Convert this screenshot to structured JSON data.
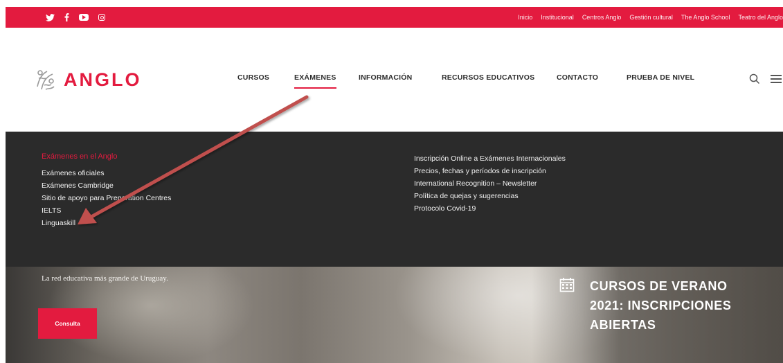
{
  "topbar": {
    "social": [
      "twitter-icon",
      "facebook-icon",
      "youtube-icon",
      "instagram-icon"
    ],
    "links": [
      "Inicio",
      "Institucional",
      "Centros Anglo",
      "Gestión cultural",
      "The Anglo School",
      "Teatro del Anglo"
    ]
  },
  "header": {
    "logo_text": "ANGLO",
    "nav": [
      "CURSOS",
      "EXÁMENES",
      "INFORMACIÓN",
      "RECURSOS EDUCATIVOS",
      "CONTACTO",
      "PRUEBA DE NIVEL"
    ],
    "active_nav": "EXÁMENES"
  },
  "dropdown": {
    "left_heading": "Exámenes en el Anglo",
    "left_items": [
      "Exámenes oficiales",
      "Exámenes Cambridge",
      "Sitio de apoyo para Preparation Centres",
      "IELTS",
      "Linguaskill"
    ],
    "right_items": [
      "Inscripción Online a Exámenes Internacionales",
      "Precios, fechas y períodos de inscripción",
      "International Recognition – Newsletter",
      "Política de quejas y sugerencias",
      "Protocolo Covid-19"
    ]
  },
  "hero": {
    "tagline": "La red educativa más grande de Uruguay.",
    "cta_label": "Consulta",
    "promo_lines": [
      "CURSOS DE VERANO",
      "2021: INSCRIPCIONES",
      "ABIERTAS"
    ]
  },
  "colors": {
    "brand_red": "#e31b3f",
    "dropdown_bg": "#2b2b2b",
    "annotation_arrow": "#c0504d"
  }
}
